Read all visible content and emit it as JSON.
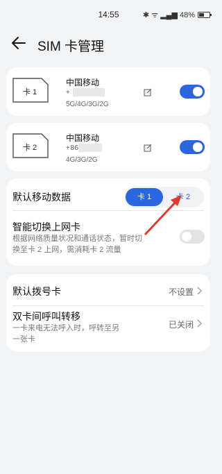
{
  "status_bar": {
    "time": "14:55",
    "icons_text": "✱ ᯤ ▂▄▆ 48%"
  },
  "header": {
    "title": "SIM 卡管理"
  },
  "sim_cards": [
    {
      "slot_label": "卡 1",
      "carrier": "中国移动",
      "phone_visible": "+              974",
      "network": "5G/4G/3G/2G",
      "enabled": true
    },
    {
      "slot_label": "卡 2",
      "carrier": "中国移动",
      "phone_visible": "+86          79442",
      "network": "4G/3G/2G",
      "enabled": true
    }
  ],
  "mobile_data": {
    "label": "默认移动数据",
    "options": [
      "卡 1",
      "卡 2"
    ],
    "selected": "卡 1"
  },
  "smart_switch": {
    "label": "智能切换上网卡",
    "description_line1": "根据网络质量状况和通话状态，暂时切",
    "description_line2": "换至卡 2 上网，需消耗卡 2 流量",
    "enabled": false
  },
  "default_dial": {
    "label": "默认拨号卡",
    "value": "不设置"
  },
  "call_forward": {
    "label": "双卡间呼叫转移",
    "description_line1": "一卡来电无法呼入时，呼转至另",
    "description_line2": "一张卡",
    "value": "已关闭"
  },
  "colors": {
    "accent": "#2a66e0",
    "annotation_arrow": "#e03a2f",
    "background": "#f1f3f5"
  }
}
